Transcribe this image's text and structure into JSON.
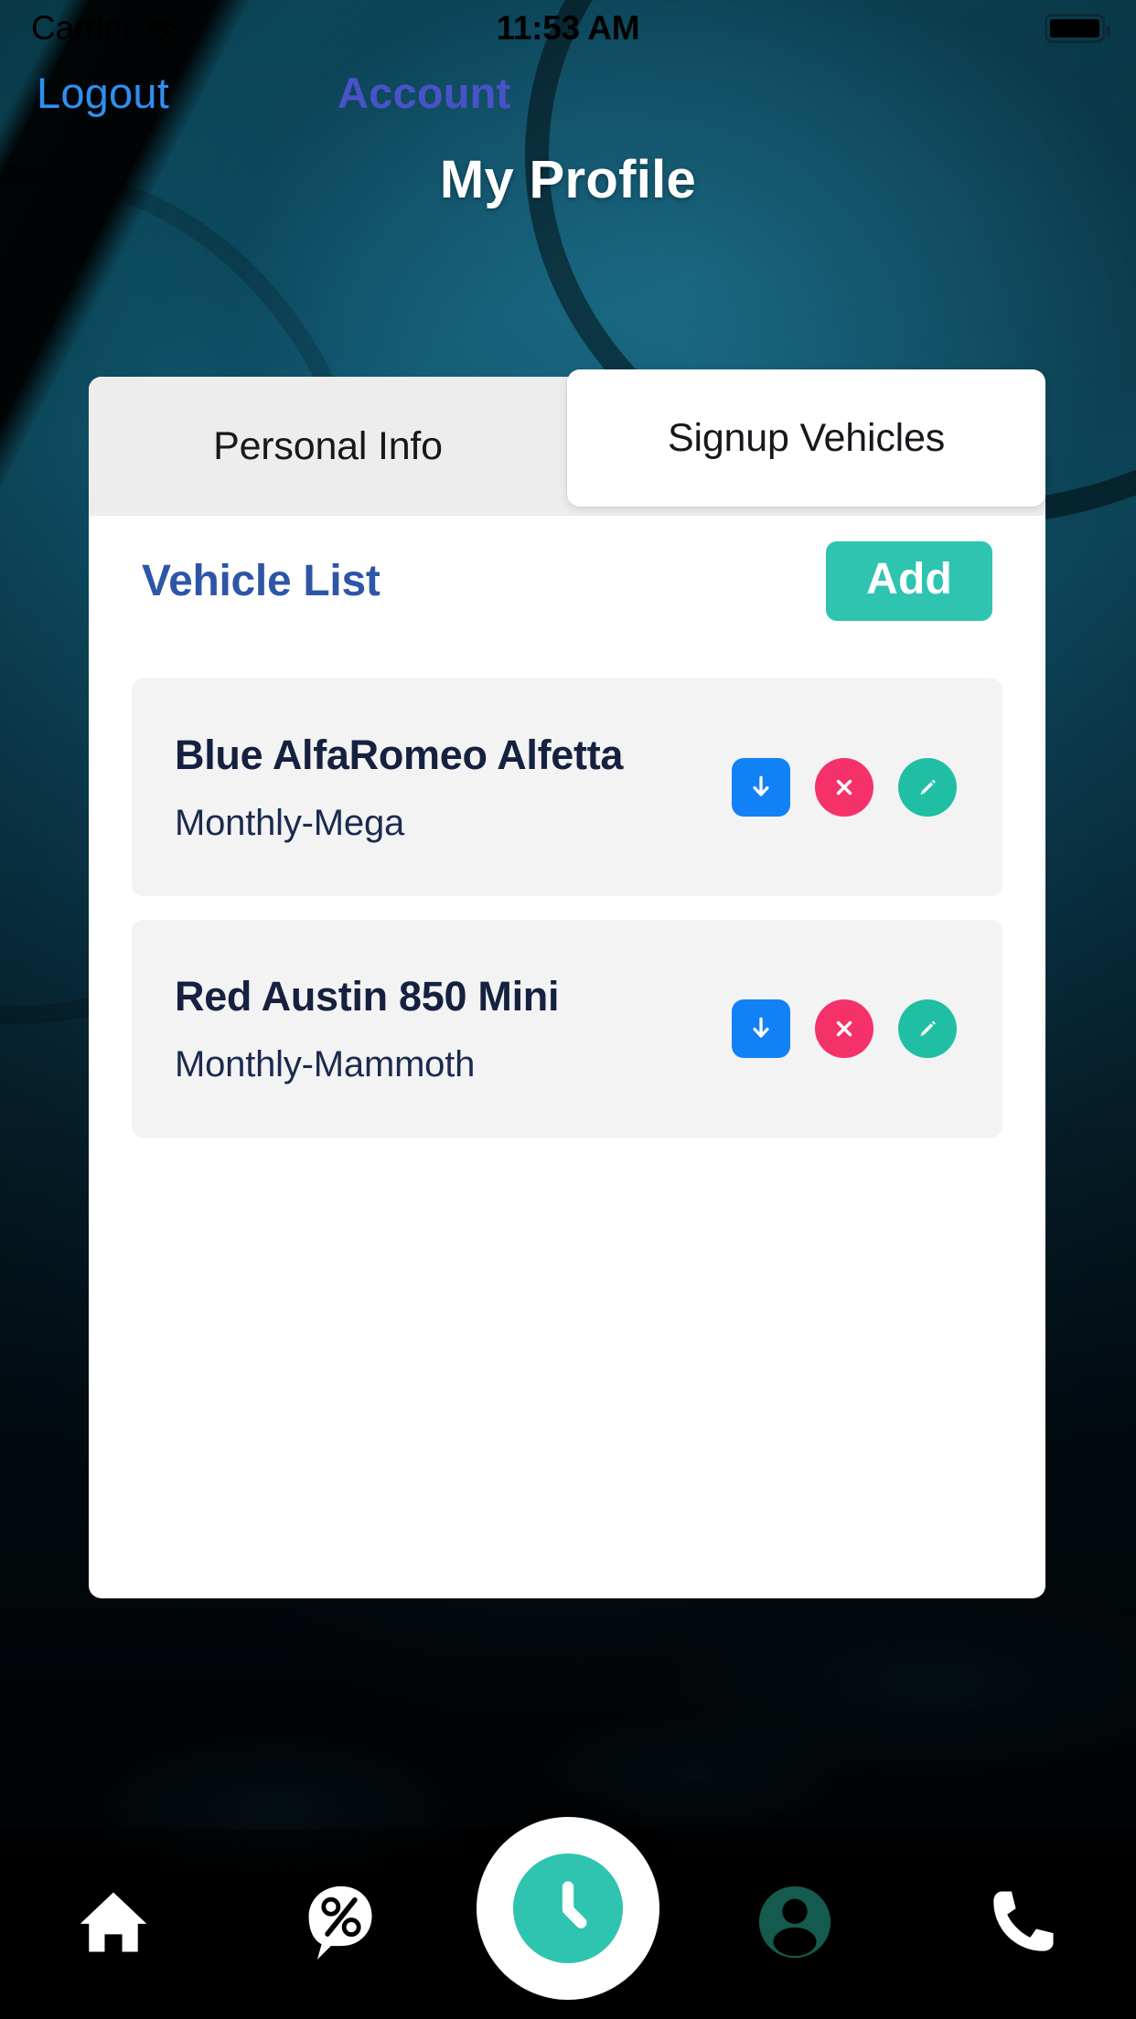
{
  "status_bar": {
    "carrier": "Carrier",
    "wifi_icon": "wifi-icon",
    "time": "11:53 AM",
    "battery_icon": "battery-full-icon"
  },
  "nav": {
    "logout_label": "Logout",
    "account_label": "Account"
  },
  "header": {
    "title": "My Profile"
  },
  "tabs": [
    {
      "label": "Personal Info",
      "active": false
    },
    {
      "label": "Signup Vehicles",
      "active": true
    }
  ],
  "vehicle_section": {
    "title": "Vehicle List",
    "add_label": "Add",
    "vehicles": [
      {
        "title": "Blue AlfaRomeo Alfetta",
        "plan": "Monthly-Mega",
        "actions": [
          "download-icon",
          "delete-icon",
          "edit-icon"
        ]
      },
      {
        "title": "Red Austin 850 Mini",
        "plan": "Monthly-Mammoth",
        "actions": [
          "download-icon",
          "delete-icon",
          "edit-icon"
        ]
      }
    ]
  },
  "bottom_nav": [
    {
      "icon": "home-icon",
      "active": false
    },
    {
      "icon": "percent-bubble-icon",
      "active": false
    },
    {
      "icon": "clock-icon",
      "active": true
    },
    {
      "icon": "person-icon",
      "active": false
    },
    {
      "icon": "phone-icon",
      "active": false
    }
  ],
  "colors": {
    "accent_teal": "#2ec4b0",
    "link_blue": "#2f8ef0",
    "account_purple": "#4a52c8",
    "title_blue": "#2e56a6",
    "card_title_navy": "#15213f",
    "download_blue": "#1281f5",
    "delete_pink": "#f5316a",
    "person_dark_teal": "#145a4f",
    "panel_white": "#ffffff",
    "tab_inactive_gray": "#ededed",
    "card_gray": "#f3f3f4"
  }
}
